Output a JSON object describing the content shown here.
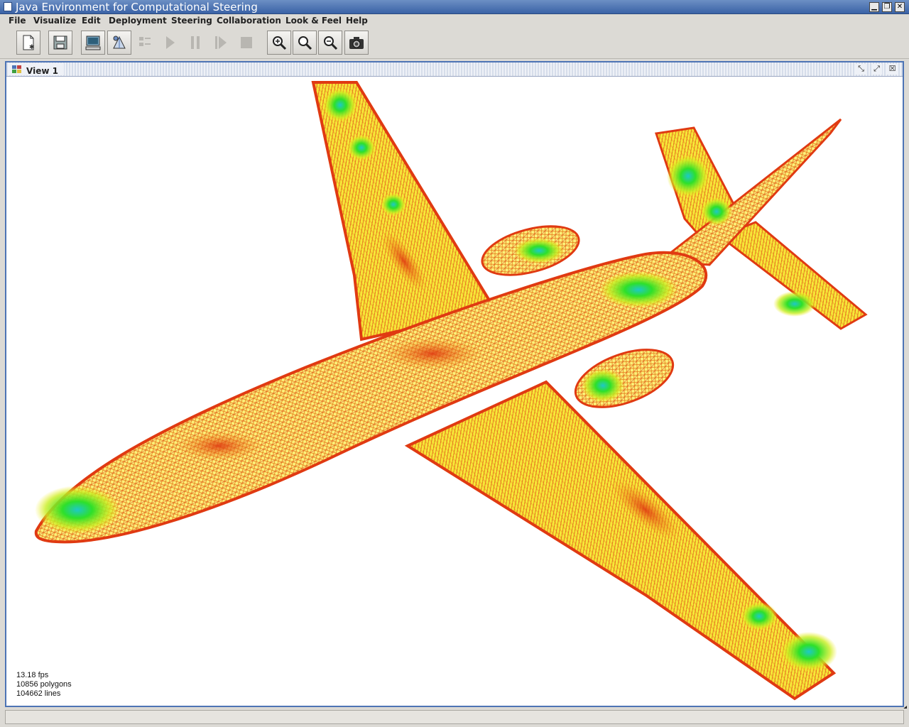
{
  "window": {
    "title": "Java Environment for Computational Steering"
  },
  "menu": {
    "items": [
      "File",
      "Visualize",
      "Edit",
      "Deployment",
      "Steering",
      "Collaboration",
      "Look & Feel",
      "Help"
    ]
  },
  "toolbar": {
    "buttons": [
      {
        "name": "new-icon",
        "enabled": true
      },
      {
        "name": "save-icon",
        "enabled": true
      },
      {
        "name": "computer-icon",
        "enabled": true
      },
      {
        "name": "deploy-icon",
        "enabled": true
      },
      {
        "name": "list-icon",
        "enabled": false
      },
      {
        "name": "play-icon",
        "enabled": false
      },
      {
        "name": "pause-icon",
        "enabled": false
      },
      {
        "name": "step-icon",
        "enabled": false
      },
      {
        "name": "stop-icon",
        "enabled": false
      },
      {
        "name": "zoom-in-icon",
        "enabled": true
      },
      {
        "name": "zoom-icon",
        "enabled": true
      },
      {
        "name": "zoom-out-icon",
        "enabled": true
      },
      {
        "name": "camera-icon",
        "enabled": true
      }
    ]
  },
  "view": {
    "title": "View 1",
    "stats": {
      "fps": "13.18 fps",
      "polygons": "10856 polygons",
      "lines": "104662 lines"
    }
  },
  "colors": {
    "titlebar": "#3a62a6",
    "frame_border": "#4d74b5",
    "mesh_red": "#e03a12",
    "mesh_orange": "#f08a16",
    "mesh_yellow": "#f6ec1e",
    "mesh_green": "#2ee02a",
    "mesh_cyan": "#1ec8c8"
  }
}
